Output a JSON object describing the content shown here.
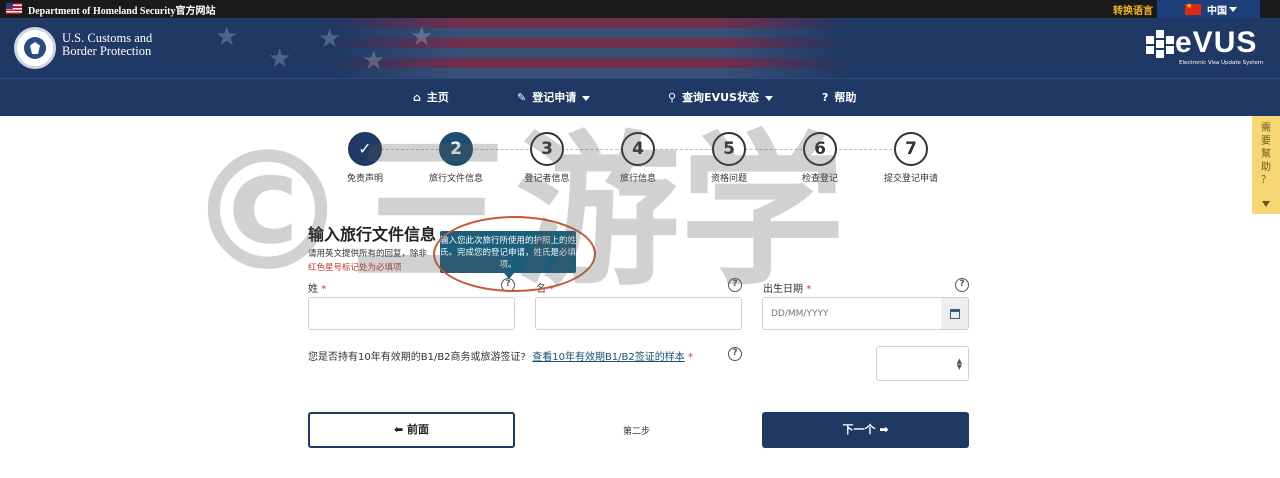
{
  "topbar": {
    "agency": "Department of Homeland Security官方网站",
    "switch_language": "转换语言",
    "language": "中国"
  },
  "header": {
    "org_line1": "U.S. Customs and",
    "org_line2": "Border Protection",
    "brand": "eVUS",
    "brand_sub": "Electronic Visa Update System"
  },
  "nav": {
    "items": [
      {
        "label": "主页",
        "icon": "home-icon"
      },
      {
        "label": "登记申请",
        "icon": "edit-icon"
      },
      {
        "label": "查询EVUS状态",
        "icon": "search-icon"
      },
      {
        "label": "帮助",
        "icon": "help-circle-icon"
      }
    ]
  },
  "help_tab": {
    "label": "需要幫助？"
  },
  "steps": [
    {
      "number": "✓",
      "label": "免责声明",
      "state": "done"
    },
    {
      "number": "2",
      "label": "旅行文件信息",
      "state": "active"
    },
    {
      "number": "3",
      "label": "登记者信息",
      "state": "pending"
    },
    {
      "number": "4",
      "label": "旅行信息",
      "state": "pending"
    },
    {
      "number": "5",
      "label": "资格问题",
      "state": "pending"
    },
    {
      "number": "6",
      "label": "检查登记",
      "state": "pending"
    },
    {
      "number": "7",
      "label": "提交登记申请",
      "state": "pending"
    }
  ],
  "form": {
    "title": "输入旅行文件信息",
    "intro_line1": "请用英文提供所有的回复，除非",
    "intro_line2": "红色星号标记处为必填项",
    "tooltip": "输入您此次旅行所使用的护照上的姓氏。完成您的登记申请，姓氏是必填项。",
    "surname_label": "姓",
    "given_name_label": "名",
    "dob_label": "出生日期",
    "required_mark": "*",
    "dob_placeholder": "DD/MM/YYYY",
    "b1b2_question": "您是否持有10年有效期的B1/B2商务或旅游签证?",
    "b1b2_link": "查看10年有效期B1/B2签证的样本"
  },
  "footer": {
    "prev_label": "前面",
    "step_text": "第二步",
    "next_label": "下一个"
  },
  "watermark": "©三游学",
  "colors": {
    "navy": "#1f3864",
    "required": "#c0392b",
    "tooltip": "#1b5e7a"
  }
}
